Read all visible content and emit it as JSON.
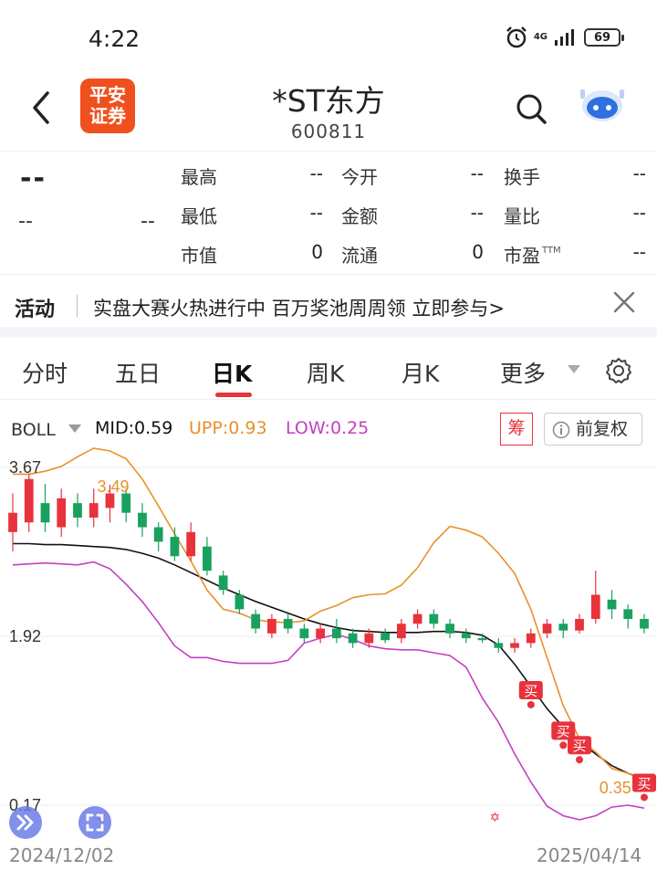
{
  "status": {
    "time": "4:22",
    "network": "4G",
    "battery": "69"
  },
  "header": {
    "brand": "平安\n证券",
    "title": "*ST东方",
    "code": "600811"
  },
  "quote": {
    "price": "--",
    "change": "--",
    "change_pct": "--",
    "fields": [
      {
        "label": "最高",
        "value": "--"
      },
      {
        "label": "今开",
        "value": "--"
      },
      {
        "label": "换手",
        "value": "--"
      },
      {
        "label": "最低",
        "value": "--"
      },
      {
        "label": "金额",
        "value": "--"
      },
      {
        "label": "量比",
        "value": "--"
      },
      {
        "label": "市值",
        "value": "0"
      },
      {
        "label": "流通",
        "value": "0"
      },
      {
        "label": "市盈",
        "value": "--",
        "sup": "TTM"
      }
    ]
  },
  "activity": {
    "tag": "活动",
    "text": "实盘大赛火热进行中 百万奖池周周领 立即参与>"
  },
  "tabs": [
    "分时",
    "五日",
    "日K",
    "周K",
    "月K",
    "更多"
  ],
  "active_tab": "日K",
  "indicator": {
    "name": "BOLL",
    "mid": "MID:0.59",
    "upp": "UPP:0.93",
    "low": "LOW:0.25",
    "chip_label": "筹",
    "adjust_label": "前复权"
  },
  "colors": {
    "up": "#e8323c",
    "down": "#19a15f",
    "upp": "#e8912a",
    "low": "#c43ec4",
    "mid": "#111111",
    "accent": "#e8323c"
  },
  "chart_data": {
    "type": "candlestick",
    "y_tick_labels": [
      "3.67",
      "1.92",
      "0.17"
    ],
    "annotations": [
      "3.49",
      "0.35"
    ],
    "signal_label": "买",
    "x_tick_labels": [
      "2024/12/02",
      "2025/04/14"
    ],
    "series": [
      {
        "name": "MID",
        "values": [
          2.88,
          2.88,
          2.87,
          2.87,
          2.86,
          2.85,
          2.84,
          2.82,
          2.78,
          2.73,
          2.66,
          2.58,
          2.5,
          2.42,
          2.35,
          2.28,
          2.22,
          2.16,
          2.1,
          2.05,
          2.01,
          1.98,
          1.97,
          1.96,
          1.96,
          1.96,
          1.97,
          1.97,
          1.96,
          1.93,
          1.83,
          1.63,
          1.4,
          1.17,
          0.98,
          0.83,
          0.7,
          0.58,
          0.5,
          0.44
        ]
      },
      {
        "name": "UPP",
        "values": [
          3.6,
          3.6,
          3.63,
          3.68,
          3.78,
          3.87,
          3.84,
          3.76,
          3.55,
          3.27,
          2.98,
          2.7,
          2.4,
          2.2,
          2.16,
          2.09,
          2.07,
          2.06,
          2.08,
          2.18,
          2.24,
          2.32,
          2.35,
          2.36,
          2.45,
          2.63,
          2.89,
          3.06,
          3.02,
          2.95,
          2.78,
          2.57,
          2.2,
          1.7,
          1.2,
          0.86,
          0.72,
          0.55,
          0.5,
          0.45
        ]
      },
      {
        "name": "LOW",
        "values": [
          2.66,
          2.67,
          2.68,
          2.67,
          2.66,
          2.69,
          2.62,
          2.46,
          2.28,
          2.06,
          1.82,
          1.7,
          1.7,
          1.66,
          1.64,
          1.64,
          1.64,
          1.67,
          1.85,
          1.9,
          1.94,
          1.89,
          1.82,
          1.79,
          1.78,
          1.78,
          1.75,
          1.72,
          1.6,
          1.28,
          1.03,
          0.7,
          0.41,
          0.16,
          0.06,
          0.02,
          0.06,
          0.15,
          0.17,
          0.14
        ]
      }
    ],
    "candles": [
      [
        3.0,
        3.2,
        2.8,
        3.4
      ],
      [
        3.1,
        3.55,
        3.0,
        3.6
      ],
      [
        3.3,
        3.1,
        3.0,
        3.5
      ],
      [
        3.05,
        3.35,
        2.95,
        3.45
      ],
      [
        3.3,
        3.15,
        3.05,
        3.4
      ],
      [
        3.15,
        3.3,
        3.05,
        3.45
      ],
      [
        3.25,
        3.4,
        3.1,
        3.49
      ],
      [
        3.4,
        3.2,
        3.1,
        3.45
      ],
      [
        3.2,
        3.05,
        2.95,
        3.3
      ],
      [
        3.05,
        2.9,
        2.8,
        3.1
      ],
      [
        2.95,
        2.75,
        2.7,
        3.05
      ],
      [
        2.75,
        3.0,
        2.7,
        3.1
      ],
      [
        2.85,
        2.6,
        2.55,
        2.95
      ],
      [
        2.55,
        2.4,
        2.35,
        2.6
      ],
      [
        2.35,
        2.2,
        2.15,
        2.4
      ],
      [
        2.15,
        2.0,
        1.95,
        2.2
      ],
      [
        1.95,
        2.1,
        1.9,
        2.15
      ],
      [
        2.1,
        2.0,
        1.95,
        2.15
      ],
      [
        2.0,
        1.9,
        1.85,
        2.05
      ],
      [
        1.9,
        2.0,
        1.85,
        2.05
      ],
      [
        2.0,
        1.9,
        1.85,
        2.1
      ],
      [
        1.95,
        1.85,
        1.8,
        2.0
      ],
      [
        1.85,
        1.95,
        1.8,
        2.0
      ],
      [
        1.95,
        1.88,
        1.85,
        2.0
      ],
      [
        1.9,
        2.05,
        1.85,
        2.1
      ],
      [
        2.05,
        2.15,
        2.0,
        2.2
      ],
      [
        2.15,
        2.05,
        2.0,
        2.2
      ],
      [
        2.05,
        1.95,
        1.9,
        2.1
      ],
      [
        1.95,
        1.9,
        1.85,
        2.0
      ],
      [
        1.9,
        1.88,
        1.85,
        1.95
      ],
      [
        1.85,
        1.8,
        1.75,
        1.9
      ],
      [
        1.8,
        1.85,
        1.75,
        1.9
      ],
      [
        1.85,
        1.95,
        1.8,
        2.0
      ],
      [
        1.95,
        2.05,
        1.9,
        2.1
      ],
      [
        2.05,
        1.98,
        1.9,
        2.1
      ],
      [
        1.98,
        2.1,
        1.95,
        2.15
      ],
      [
        2.1,
        2.35,
        2.05,
        2.6
      ],
      [
        2.3,
        2.2,
        2.1,
        2.4
      ],
      [
        2.2,
        2.1,
        2.0,
        2.25
      ],
      [
        2.1,
        2.0,
        1.95,
        2.15
      ]
    ]
  }
}
